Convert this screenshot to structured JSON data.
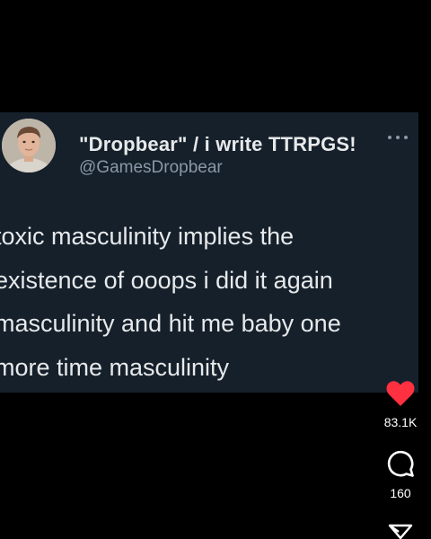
{
  "tweet": {
    "display_name": "\"Dropbear\" / i write TTRPGS!",
    "handle": "@GamesDropbear",
    "text_lines": [
      "toxic masculinity implies the",
      "existence of ooops i did it again",
      "masculinity and hit me baby one",
      "more time masculinity"
    ],
    "more_icon": "more-dots-icon",
    "card_color": "#15202b"
  },
  "actions": {
    "like": {
      "icon": "heart-icon",
      "count": "83.1K",
      "color": "#ff3040"
    },
    "comment": {
      "icon": "comment-bubble-icon",
      "count": "160"
    },
    "share": {
      "icon": "send-icon"
    }
  }
}
